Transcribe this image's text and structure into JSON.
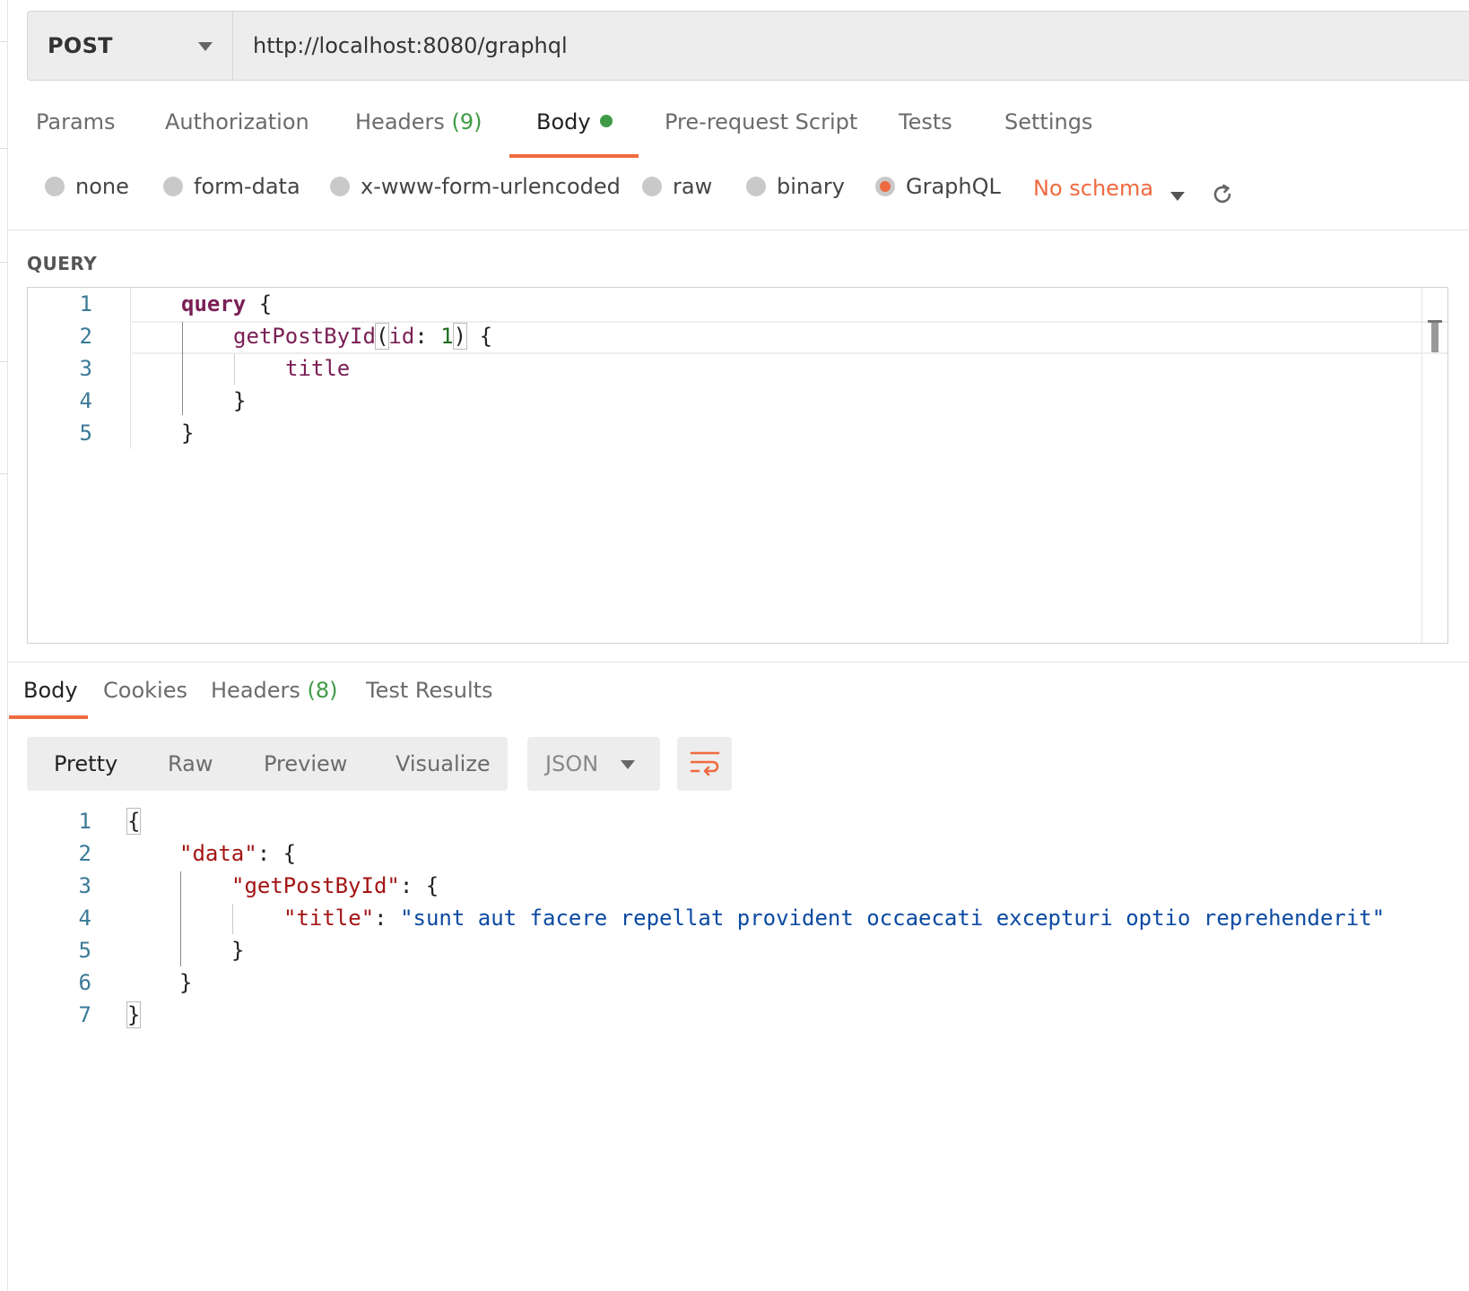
{
  "request": {
    "method": "POST",
    "url": "http://localhost:8080/graphql",
    "tabs": [
      {
        "label": "Params"
      },
      {
        "label": "Authorization"
      },
      {
        "label": "Headers",
        "count": "(9)"
      },
      {
        "label": "Body"
      },
      {
        "label": "Pre-request Script"
      },
      {
        "label": "Tests"
      },
      {
        "label": "Settings"
      }
    ],
    "active_tab": "Body",
    "body_types": [
      "none",
      "form-data",
      "x-www-form-urlencoded",
      "raw",
      "binary",
      "GraphQL"
    ],
    "selected_body_type": "GraphQL",
    "schema": "No schema",
    "query_label": "QUERY",
    "query_lines": [
      "1",
      "2",
      "3",
      "4",
      "5"
    ]
  },
  "response": {
    "tabs": [
      {
        "label": "Body"
      },
      {
        "label": "Cookies"
      },
      {
        "label": "Headers",
        "count": "(8)"
      },
      {
        "label": "Test Results"
      }
    ],
    "active_tab": "Body",
    "view_modes": [
      "Pretty",
      "Raw",
      "Preview",
      "Visualize"
    ],
    "active_view": "Pretty",
    "format": "JSON",
    "line_numbers": [
      "1",
      "2",
      "3",
      "4",
      "5",
      "6",
      "7"
    ],
    "json": {
      "key_data": "\"data\"",
      "key_getPostById": "\"getPostById\"",
      "key_title": "\"title\"",
      "value_title": "\"sunt aut facere repellat provident occaecati excepturi optio reprehenderit\""
    }
  },
  "colors": {
    "accent": "#ef6a3f",
    "count_green": "#3f9b45",
    "line_number": "#3b7a98",
    "keyword": "#7a1f55",
    "json_key": "#a31515",
    "json_string": "#0b4aa2"
  },
  "icons": [
    "caret-down-icon",
    "refresh-icon",
    "wrap-lines-icon"
  ]
}
